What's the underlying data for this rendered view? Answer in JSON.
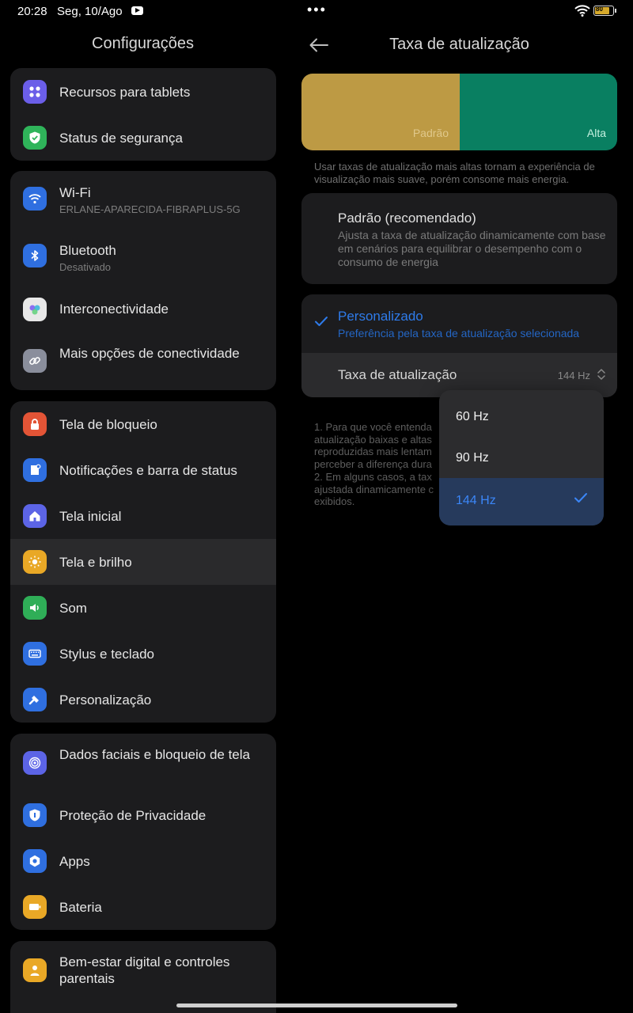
{
  "status_bar": {
    "time": "20:28",
    "date": "Seg, 10/Ago",
    "battery_text": "80"
  },
  "left": {
    "title": "Configurações",
    "groups": [
      {
        "items": [
          {
            "label": "Recursos para tablets",
            "icon": "tablet-features-icon",
            "color": "#6b5ee8"
          },
          {
            "label": "Status de segurança",
            "icon": "security-shield-icon",
            "color": "#2fb45a"
          }
        ]
      },
      {
        "items": [
          {
            "label": "Wi-Fi",
            "sub": "ERLANE-APARECIDA-FIBRAPLUS-5G",
            "icon": "wifi-icon",
            "color": "#2f6fe0"
          },
          {
            "label": "Bluetooth",
            "sub": "Desativado",
            "icon": "bluetooth-icon",
            "color": "#2f6fe0"
          },
          {
            "label": "Interconectividade",
            "icon": "interconnectivity-icon",
            "color": "#e8e8e8"
          },
          {
            "label": "Mais opções de conectividade",
            "icon": "more-connectivity-icon",
            "color": "#8a8e9c"
          }
        ]
      },
      {
        "items": [
          {
            "label": "Tela de bloqueio",
            "icon": "lock-icon",
            "color": "#e35436"
          },
          {
            "label": "Notificações e barra de status",
            "icon": "notifications-icon",
            "color": "#2f6fe0"
          },
          {
            "label": "Tela inicial",
            "icon": "home-icon",
            "color": "#5c64e6"
          },
          {
            "label": "Tela e brilho",
            "icon": "brightness-icon",
            "color": "#e9a826"
          },
          {
            "label": "Som",
            "icon": "sound-icon",
            "color": "#2fae57"
          },
          {
            "label": "Stylus e teclado",
            "icon": "keyboard-icon",
            "color": "#2f6fe0"
          },
          {
            "label": "Personalização",
            "icon": "personalization-icon",
            "color": "#2f6fe0"
          }
        ]
      },
      {
        "items": [
          {
            "label": "Dados faciais e bloqueio de tela",
            "icon": "face-data-icon",
            "color": "#5c64e6"
          },
          {
            "label": "Proteção de Privacidade",
            "icon": "privacy-icon",
            "color": "#2f6fe0"
          },
          {
            "label": "Apps",
            "icon": "apps-gear-icon",
            "color": "#2f6fe0"
          },
          {
            "label": "Bateria",
            "icon": "battery-icon",
            "color": "#e9a826"
          }
        ]
      },
      {
        "items": [
          {
            "label": "Bem-estar digital e controles parentais",
            "icon": "wellbeing-icon",
            "color": "#e9a826"
          }
        ]
      }
    ]
  },
  "right": {
    "title": "Taxa de atualização",
    "preview": {
      "standard_label": "Padrão",
      "high_label": "Alta",
      "standard_color": "#bd9a44",
      "high_color": "#097f61"
    },
    "description": "Usar taxas de atualização mais altas tornam a experiência de visualização mais suave, porém consome mais energia.",
    "option_default": {
      "title": "Padrão (recomendado)",
      "sub": "Ajusta a taxa de atualização dinamicamente com base em cenários para equilibrar o desempenho com o consumo de energia"
    },
    "option_custom": {
      "title": "Personalizado",
      "sub": "Preferência pela taxa de atualização selecionada"
    },
    "rate_row": {
      "label": "Taxa de atualização",
      "value": "144 Hz"
    },
    "notes": [
      "1. Para que você entenda",
      "atualização baixas e altas",
      "reproduzidas mais lentam",
      "perceber a diferença dura",
      "2. Em alguns casos, a tax",
      "ajustada dinamicamente c",
      "exibidos."
    ]
  },
  "dropdown": {
    "options": [
      "60 Hz",
      "90 Hz",
      "144 Hz"
    ],
    "selected": "144 Hz"
  },
  "accent_color": "#2e7bea"
}
